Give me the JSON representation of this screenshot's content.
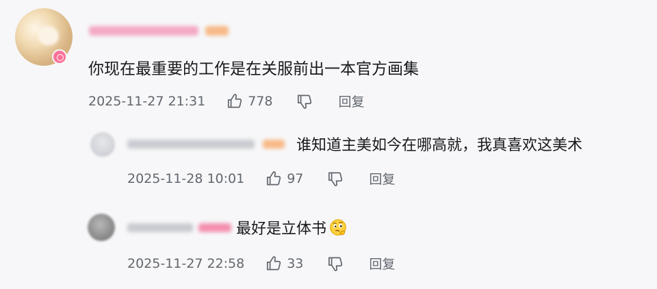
{
  "comments": [
    {
      "content": "你现在最重要的工作是在关服前出一本官方画集",
      "time": "2025-11-27 21:31",
      "likes": "778",
      "reply_label": "回复"
    }
  ],
  "replies": [
    {
      "content": "谁知道主美如今在哪高就，我真喜欢这美术",
      "time": "2025-11-28 10:01",
      "likes": "97",
      "reply_label": "回复"
    },
    {
      "content": "最好是立体书",
      "emoji": "thinking-face-emoji",
      "time": "2025-11-27 22:58",
      "likes": "33",
      "reply_label": "回复"
    }
  ],
  "icons": {
    "like": "thumbs-up-icon",
    "dislike": "thumbs-down-icon"
  },
  "colors": {
    "background": "#f7f7f9",
    "text": "#18191c",
    "meta": "#61666d",
    "badge_pink": "#fb7299"
  }
}
